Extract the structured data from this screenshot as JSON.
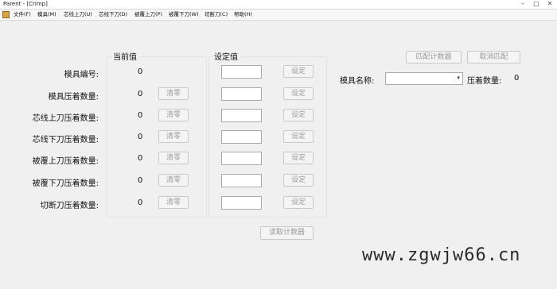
{
  "window": {
    "title": "Parent - [Crimp]",
    "controls": [
      "–",
      "□",
      "✕"
    ]
  },
  "menu": {
    "items": [
      "文件(F)",
      "模具(M)",
      "芯线上刀(U)",
      "芯线下刀(D)",
      "被覆上刀(P)",
      "被覆下刀(W)",
      "切断刀(C)",
      "帮助(H)"
    ]
  },
  "groups": {
    "current_title": "当前值",
    "setting_title": "设定值"
  },
  "rows": [
    {
      "label": "模具编号:",
      "value": "0",
      "clear": "",
      "set": "设定"
    },
    {
      "label": "模具压着数量:",
      "value": "0",
      "clear": "清零",
      "set": "设定"
    },
    {
      "label": "芯线上刀压着数量:",
      "value": "0",
      "clear": "清零",
      "set": "设定"
    },
    {
      "label": "芯线下刀压着数量:",
      "value": "0",
      "clear": "清零",
      "set": "设定"
    },
    {
      "label": "被覆上刀压着数量:",
      "value": "0",
      "clear": "清零",
      "set": "设定"
    },
    {
      "label": "被覆下刀压着数量:",
      "value": "0",
      "clear": "清零",
      "set": "设定"
    },
    {
      "label": "切断刀压着数量:",
      "value": "0",
      "clear": "清零",
      "set": "设定"
    }
  ],
  "read_counter": "读取计数器",
  "right_panel": {
    "match_counter": "匹配计数器",
    "cancel_match": "取消匹配",
    "mold_name_label": "模具名称:",
    "mold_name_value": "",
    "press_count_label": "压着数量:",
    "press_count_value": "0"
  },
  "watermark": "www.zgwjw66.cn"
}
